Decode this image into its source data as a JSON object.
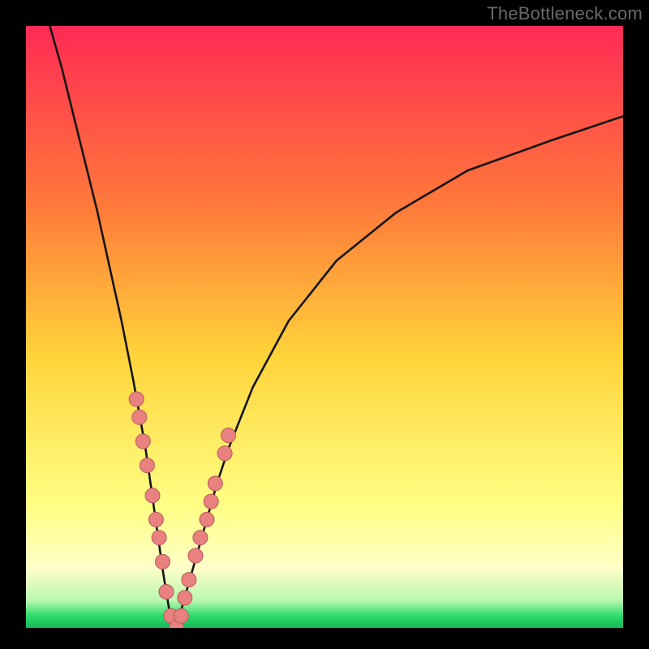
{
  "watermark": "TheBottleneck.com",
  "colors": {
    "frame": "#000000",
    "curve": "#151515",
    "dot_fill": "#e98181",
    "dot_stroke": "#b85a5a",
    "green_band": "#2bdc6b"
  },
  "chart_data": {
    "type": "line",
    "title": "",
    "xlabel": "",
    "ylabel": "",
    "xlim": [
      0,
      100
    ],
    "ylim": [
      0,
      100
    ],
    "grid": false,
    "background": "vertical gradient red→orange→yellow→pale-yellow→green (top→bottom) within a black frame",
    "series": [
      {
        "name": "bottleneck-curve",
        "x": [
          4,
          6,
          8,
          10,
          12,
          14,
          16,
          18,
          20,
          21,
          22,
          23,
          24,
          25,
          26,
          28,
          30,
          32,
          34,
          38,
          44,
          52,
          62,
          74,
          88,
          100
        ],
        "values": [
          100,
          93,
          85,
          77,
          69,
          60,
          51,
          41,
          30,
          23,
          16,
          9,
          3,
          0,
          3,
          10,
          17,
          24,
          30,
          40,
          51,
          61,
          69,
          76,
          81,
          85
        ]
      }
    ],
    "dots": {
      "name": "highlighted-points",
      "x": [
        18.5,
        19.0,
        19.6,
        20.3,
        21.2,
        21.8,
        22.3,
        22.9,
        23.5,
        24.3,
        25.2,
        26.0,
        26.6,
        27.3,
        28.4,
        29.2,
        30.3,
        31.0,
        31.7,
        33.3,
        33.9
      ],
      "values": [
        38,
        35,
        31,
        27,
        22,
        18,
        15,
        11,
        6,
        2,
        0,
        2,
        5,
        8,
        12,
        15,
        18,
        21,
        24,
        29,
        32
      ]
    },
    "gradient_stops": [
      {
        "offset": 0.0,
        "color": "#ff2a55"
      },
      {
        "offset": 0.3,
        "color": "#ff7a3a"
      },
      {
        "offset": 0.55,
        "color": "#ffd43a"
      },
      {
        "offset": 0.8,
        "color": "#ffff85"
      },
      {
        "offset": 0.9,
        "color": "#ffffc8"
      },
      {
        "offset": 0.955,
        "color": "#b8f7b0"
      },
      {
        "offset": 0.98,
        "color": "#2bdc6b"
      },
      {
        "offset": 1.0,
        "color": "#16b858"
      }
    ]
  }
}
